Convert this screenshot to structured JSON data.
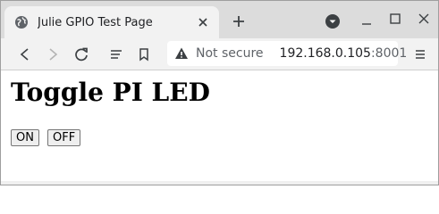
{
  "browser": {
    "tab": {
      "title": "Julie GPIO Test Page",
      "favicon": "globe-icon"
    },
    "address": {
      "security": "Not secure",
      "host": "192.168.0.105",
      "port": ":8001"
    },
    "icons": {
      "close_tab": "close-icon",
      "new_tab": "plus-icon",
      "tab_search": "tab-search-icon",
      "back": "back-icon",
      "forward": "forward-icon",
      "reload": "reload-icon",
      "reader": "reader-icon",
      "bookmark": "bookmark-icon",
      "warning": "warning-icon",
      "menu": "menu-icon"
    }
  },
  "page": {
    "heading": "Toggle PI LED",
    "buttons": {
      "on": "ON",
      "off": "OFF"
    }
  },
  "colors": {
    "tabstrip": "#dcdcdc",
    "toolbar": "#f2f2f2",
    "page": "#ffffff"
  }
}
